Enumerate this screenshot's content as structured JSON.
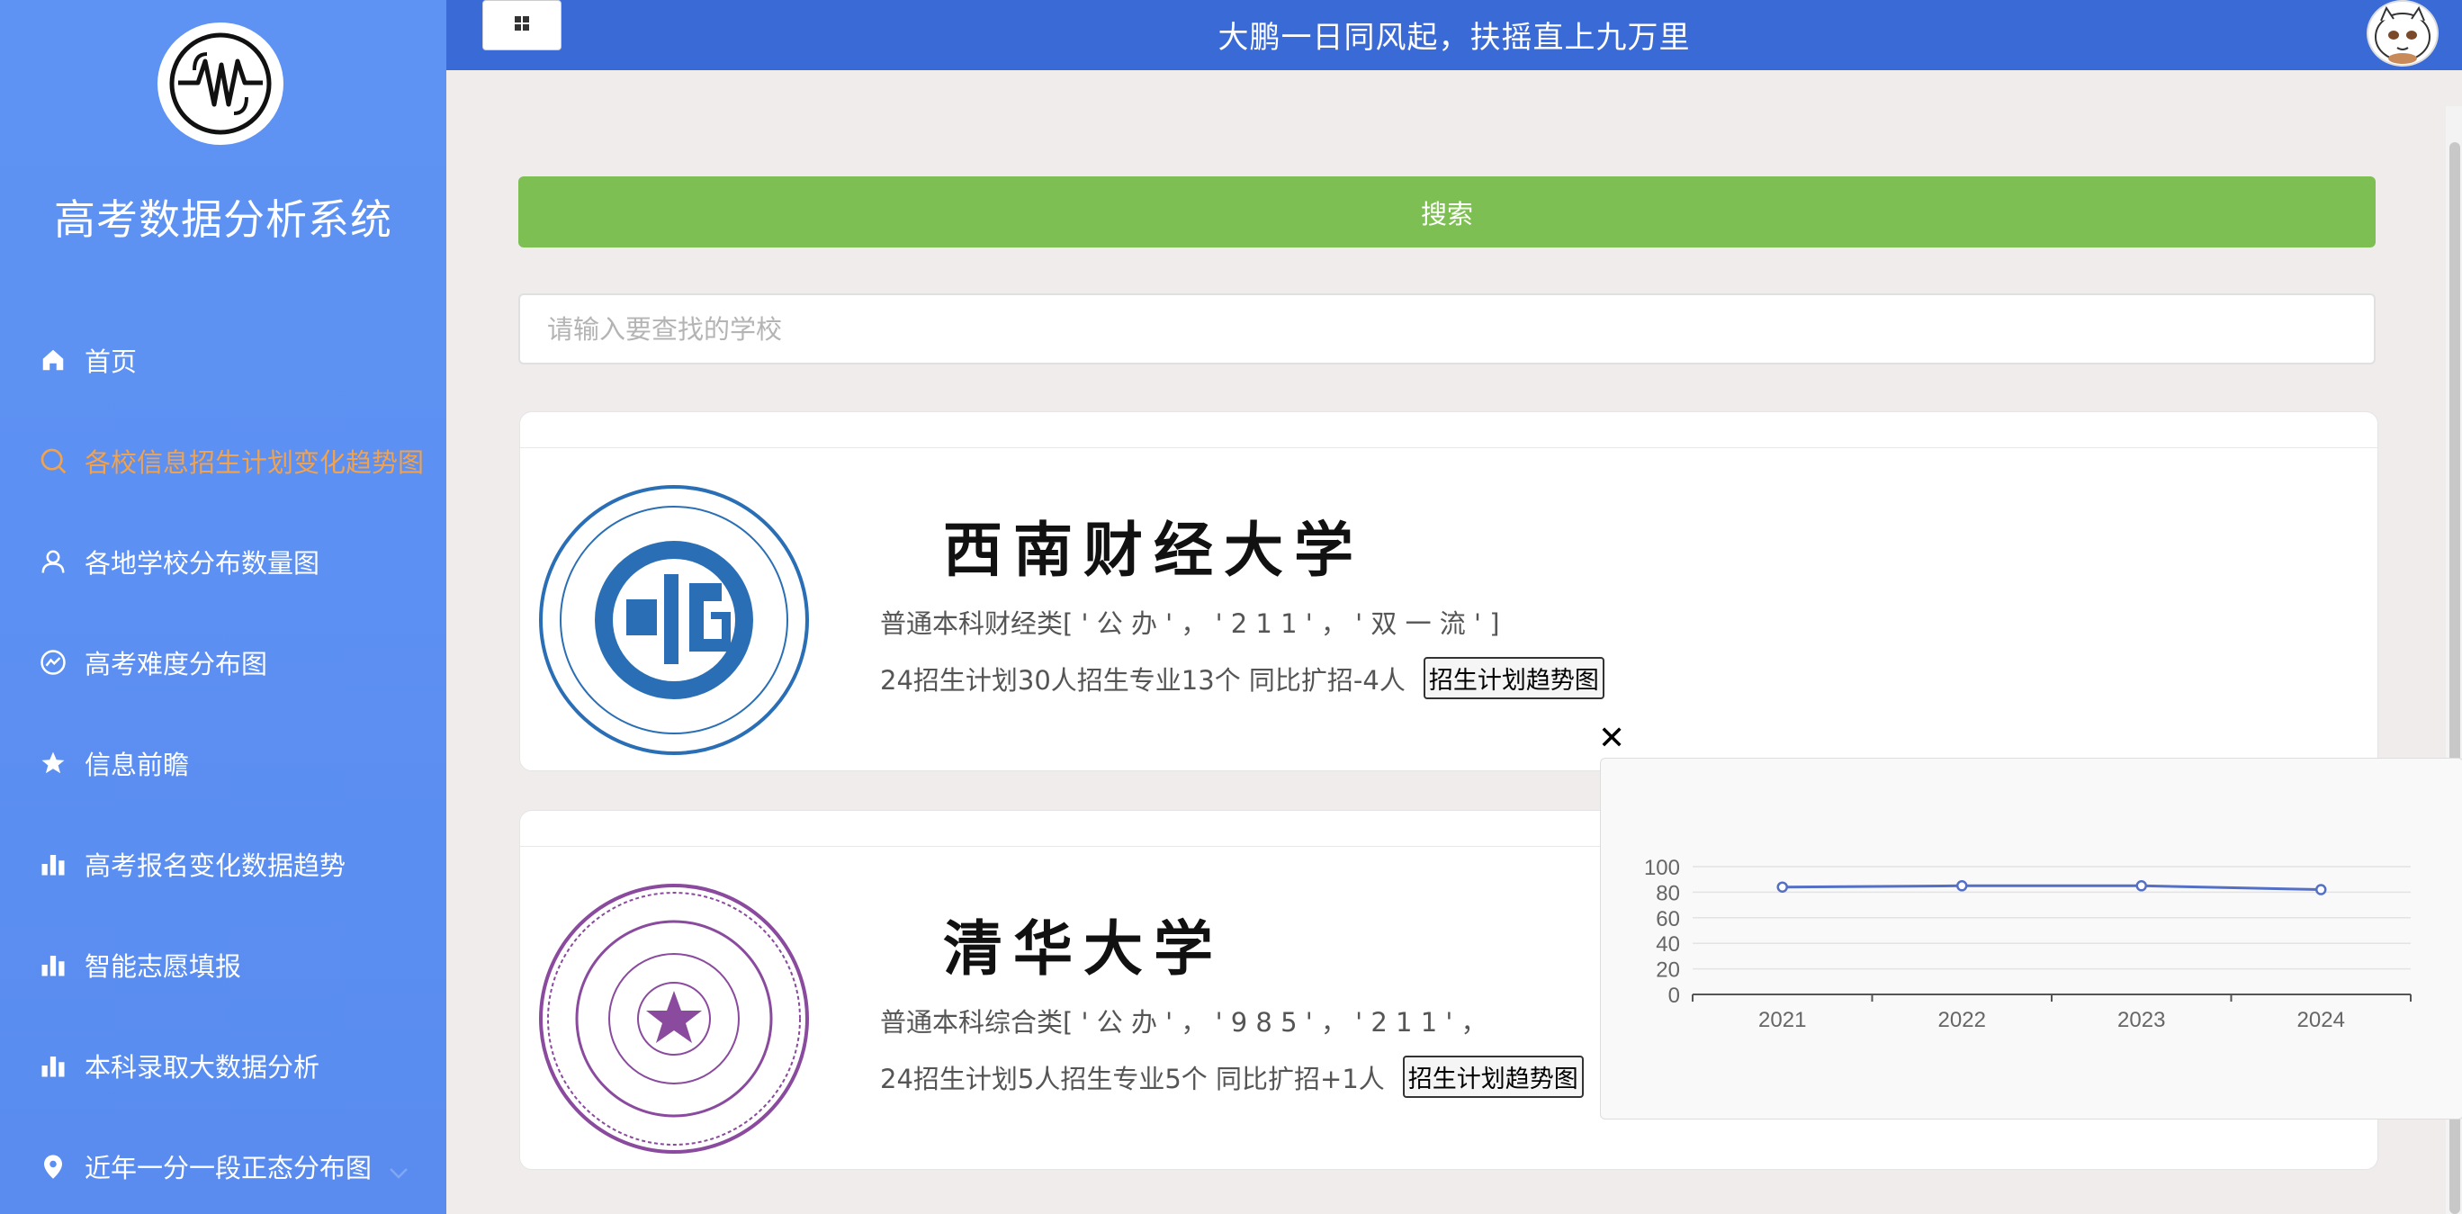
{
  "sidebar": {
    "title": "高考数据分析系统",
    "items": [
      {
        "label": "首页",
        "icon": "home-icon",
        "active": false
      },
      {
        "label": "各校信息招生计划变化趋势图",
        "icon": "search-icon",
        "active": true
      },
      {
        "label": "各地学校分布数量图",
        "icon": "user-icon",
        "active": false
      },
      {
        "label": "高考难度分布图",
        "icon": "trend-circle-icon",
        "active": false
      },
      {
        "label": "信息前瞻",
        "icon": "star-icon",
        "active": false
      },
      {
        "label": "高考报名变化数据趋势",
        "icon": "bar-chart-icon",
        "active": false
      },
      {
        "label": "智能志愿填报",
        "icon": "bar-chart-icon",
        "active": false
      },
      {
        "label": "本科录取大数据分析",
        "icon": "bar-chart-icon",
        "active": false
      },
      {
        "label": "近年一分一段正态分布图",
        "icon": "location-icon",
        "active": false
      }
    ]
  },
  "header": {
    "title": "大鹏一日同风起，扶摇直上九万里"
  },
  "search": {
    "button_label": "搜索",
    "placeholder": "请输入要查找的学校"
  },
  "schools": [
    {
      "name": "西南财经大学",
      "type": "普通本科财经类[ ' 公 办 ' ， ' 2 1 1 ' ， ' 双 一 流 ' ]",
      "stat": "24招生计划30人招生专业13个  同比扩招-4人",
      "button": "招生计划趋势图"
    },
    {
      "name": "清华大学",
      "type": "普通本科综合类[ ' 公 办 ' ， ' 9 8 5 ' ， ' 2 1 1 ' ，",
      "stat": "24招生计划5人招生专业5个  同比扩招+1人",
      "button": "招生计划趋势图"
    }
  ],
  "popup": {
    "close_label": "✕"
  },
  "chart_data": {
    "type": "line",
    "categories": [
      "2021",
      "2022",
      "2023",
      "2024"
    ],
    "series": [
      {
        "values": [
          84,
          85,
          85,
          82
        ]
      }
    ],
    "ylim": [
      0,
      100
    ],
    "yticks": [
      0,
      20,
      40,
      60,
      80,
      100
    ],
    "color": "#5470c6",
    "grid": true
  },
  "colors": {
    "sidebar": "#5b8ff2",
    "header": "#3a6ad6",
    "accent_active": "#f0a24e",
    "search_button": "#7dbf52"
  }
}
